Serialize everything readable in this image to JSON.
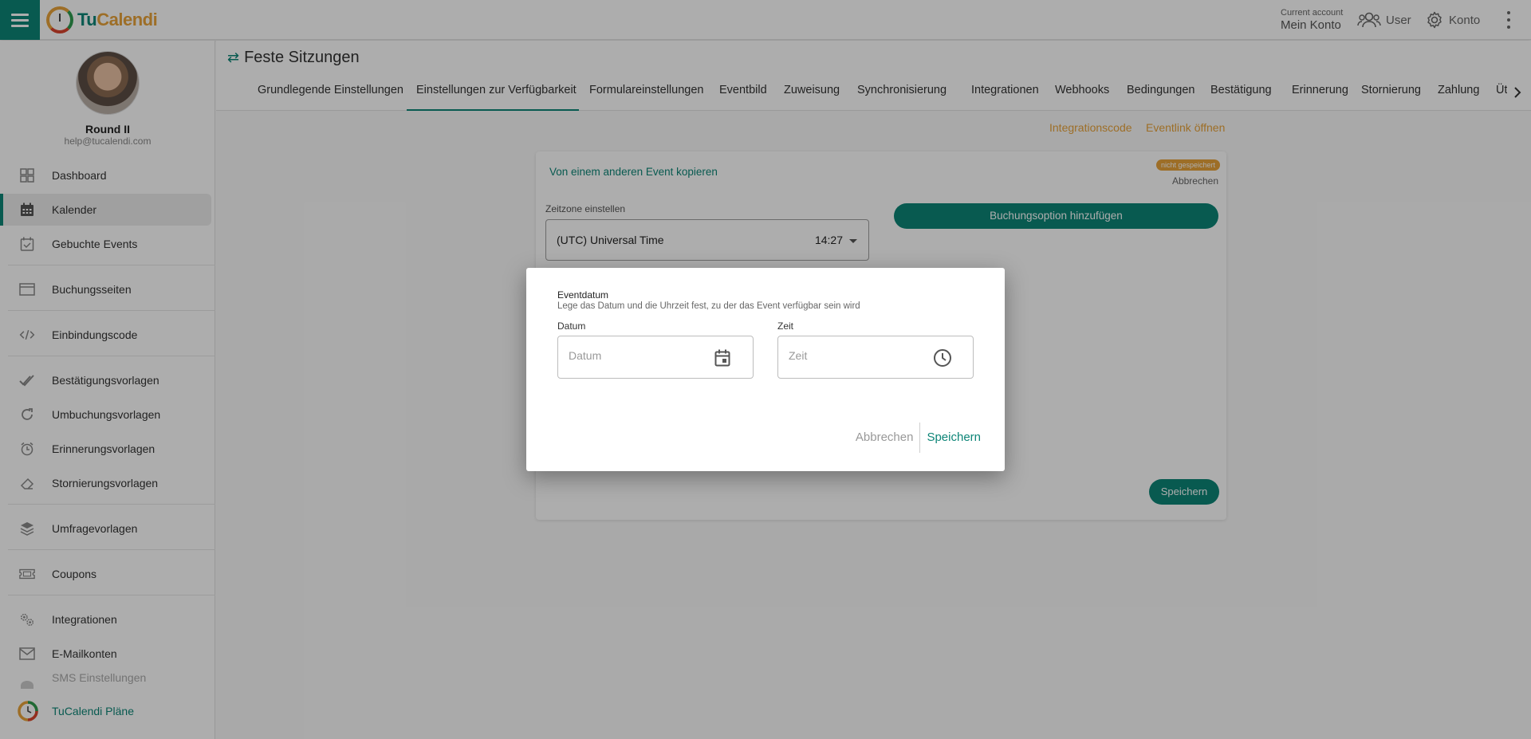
{
  "app": {
    "logo_tu": "Tu",
    "logo_calendi": "Calendi"
  },
  "topbar": {
    "account_small": "Current account",
    "account_big": "Mein Konto",
    "user_label": "User",
    "konto_label": "Konto"
  },
  "profile": {
    "name": "Round II",
    "email": "help@tucalendi.com"
  },
  "sidebar": {
    "items": [
      {
        "label": "Dashboard"
      },
      {
        "label": "Kalender"
      },
      {
        "label": "Gebuchte Events"
      },
      {
        "label": "Buchungsseiten"
      },
      {
        "label": "Einbindungscode"
      },
      {
        "label": "Bestätigungsvorlagen"
      },
      {
        "label": "Umbuchungsvorlagen"
      },
      {
        "label": "Erinnerungsvorlagen"
      },
      {
        "label": "Stornierungsvorlagen"
      },
      {
        "label": "Umfragevorlagen"
      },
      {
        "label": "Coupons"
      },
      {
        "label": "Integrationen"
      },
      {
        "label": "E-Mailkonten"
      },
      {
        "label": "SMS Einstellungen"
      },
      {
        "label": "TuCalendi Pläne"
      }
    ],
    "active_index": 1
  },
  "page": {
    "title": "Feste Sitzungen"
  },
  "tabs": [
    {
      "label": "Grundlegende Einstellungen"
    },
    {
      "label": "Einstellungen zur Verfügbarkeit"
    },
    {
      "label": "Formulareinstellungen"
    },
    {
      "label": "Eventbild"
    },
    {
      "label": "Zuweisung"
    },
    {
      "label": "Synchronisierung"
    },
    {
      "label": "Integrationen"
    },
    {
      "label": "Webhooks"
    },
    {
      "label": "Bedingungen"
    },
    {
      "label": "Bestätigung"
    },
    {
      "label": "Erinnerung"
    },
    {
      "label": "Stornierung"
    },
    {
      "label": "Zahlung"
    },
    {
      "label": "Üt"
    }
  ],
  "actions": {
    "integration_code": "Integrationscode",
    "open_event_link": "Eventlink öffnen"
  },
  "card": {
    "copy_link": "Von einem anderen Event kopieren",
    "status_badge": "nicht gespeichert",
    "cancel": "Abbrechen",
    "timezone_label": "Zeitzone einstellen",
    "timezone_value": "(UTC) Universal Time",
    "timezone_time": "14:27",
    "add_option": "Buchungsoption hinzufügen",
    "save": "Speichern"
  },
  "dialog": {
    "title": "Eventdatum",
    "subtitle": "Lege das Datum und die Uhrzeit fest, zu der das Event verfügbar sein wird",
    "date_label": "Datum",
    "date_placeholder": "Datum",
    "time_label": "Zeit",
    "time_placeholder": "Zeit",
    "cancel": "Abbrechen",
    "save": "Speichern"
  },
  "colors": {
    "primary": "#0d8577",
    "accent": "#e8a33a"
  }
}
